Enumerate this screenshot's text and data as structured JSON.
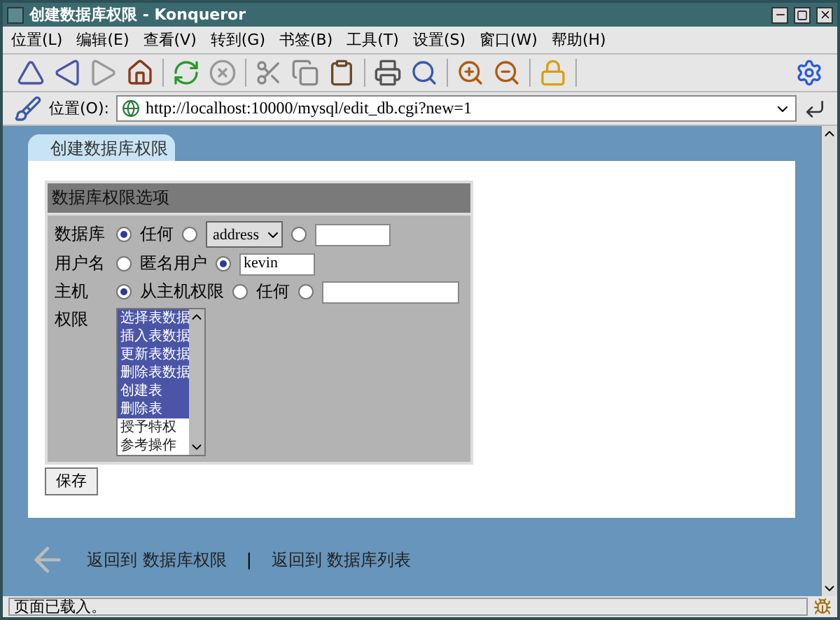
{
  "window": {
    "title": "创建数据库权限 - Konqueror"
  },
  "menu": [
    "位置(L)",
    "编辑(E)",
    "查看(V)",
    "转到(G)",
    "书签(B)",
    "工具(T)",
    "设置(S)",
    "窗口(W)",
    "帮助(H)"
  ],
  "location": {
    "label": "位置(O):",
    "url": "http://localhost:10000/mysql/edit_db.cgi?new=1"
  },
  "tab": {
    "label": "创建数据库权限"
  },
  "form": {
    "title": "数据库权限选项",
    "rows": [
      {
        "label": "数据库",
        "items": [
          {
            "kind": "radio",
            "selected": true
          },
          {
            "kind": "text",
            "text": "任何"
          },
          {
            "kind": "radio",
            "selected": false
          },
          {
            "kind": "select",
            "value": "address"
          },
          {
            "kind": "radio",
            "selected": false
          },
          {
            "kind": "input"
          }
        ]
      },
      {
        "label": "用户名",
        "items": [
          {
            "kind": "radio",
            "selected": false
          },
          {
            "kind": "text",
            "text": "匿名用户"
          },
          {
            "kind": "radio",
            "selected": true
          },
          {
            "kind": "input",
            "value": "kevin"
          }
        ]
      },
      {
        "label": "主机",
        "items": [
          {
            "kind": "radio",
            "selected": true
          },
          {
            "kind": "text",
            "text": "从主机权限"
          },
          {
            "kind": "radio",
            "selected": false
          },
          {
            "kind": "text",
            "text": "任何"
          },
          {
            "kind": "radio",
            "selected": false
          },
          {
            "kind": "wide-input"
          }
        ]
      }
    ],
    "privileges": {
      "label": "权限",
      "items": [
        {
          "text": "选择表数据",
          "selected": true
        },
        {
          "text": "插入表数据",
          "selected": true
        },
        {
          "text": "更新表数据",
          "selected": true
        },
        {
          "text": "删除表数据",
          "selected": true
        },
        {
          "text": "创建表",
          "selected": true
        },
        {
          "text": "删除表",
          "selected": true
        },
        {
          "text": "授予特权",
          "selected": false
        },
        {
          "text": "参考操作",
          "selected": false
        }
      ]
    },
    "save": "保存"
  },
  "footer": {
    "links": [
      {
        "text": "返回到 数据库权限"
      },
      {
        "text": "返回到 数据库列表"
      }
    ],
    "separator": "|"
  },
  "status": "页面已载入。"
}
